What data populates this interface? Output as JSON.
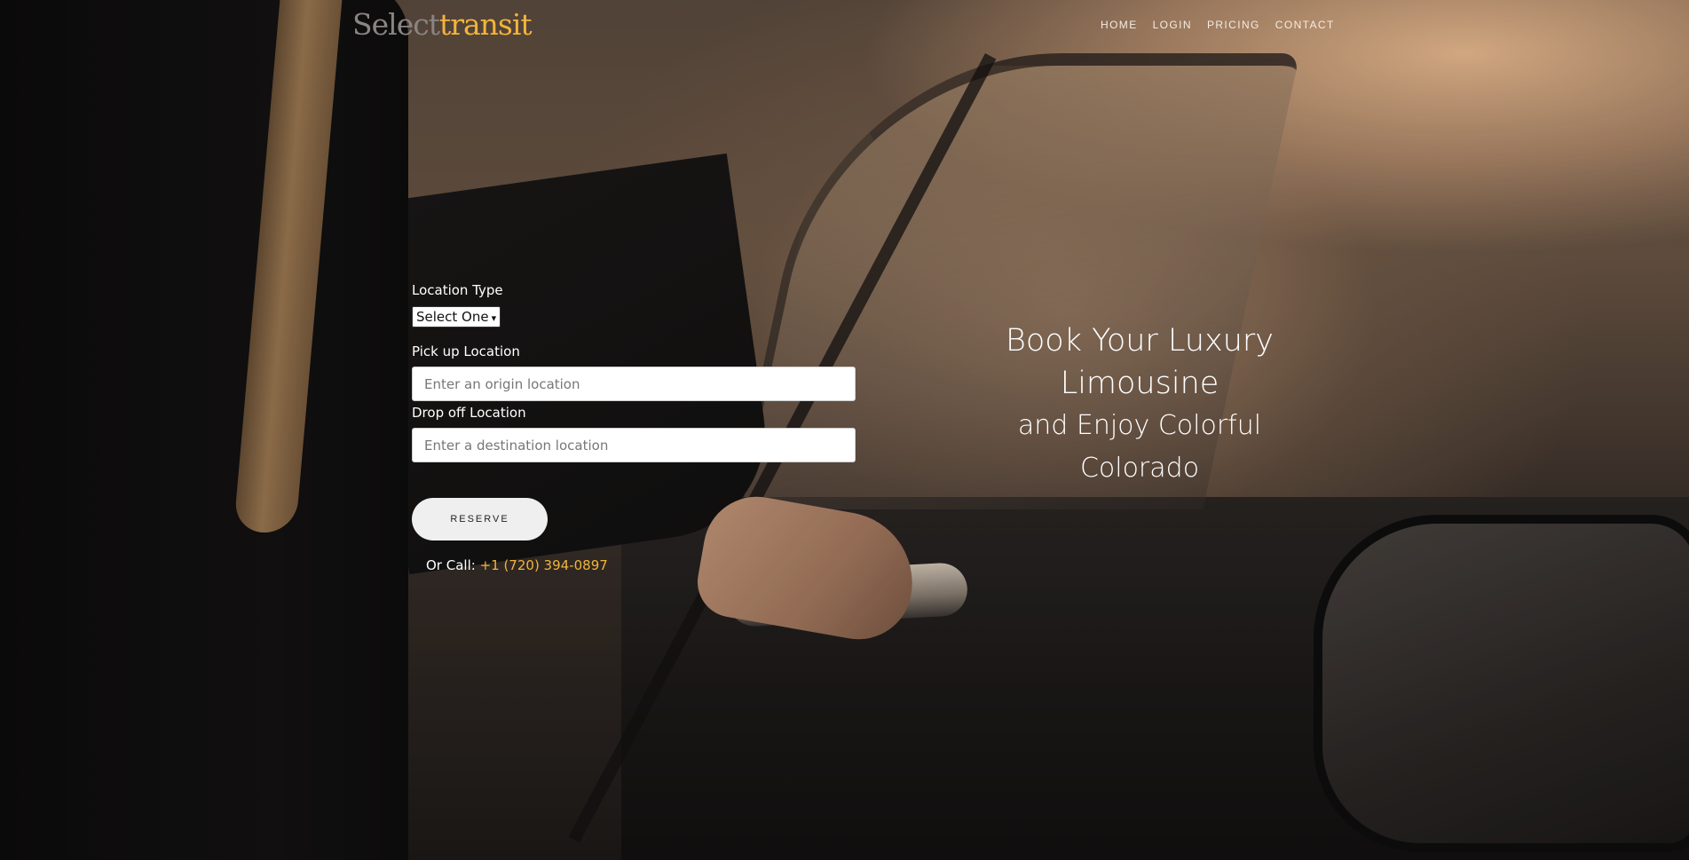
{
  "header": {
    "logo": {
      "part1": "Select",
      "part2": "transit"
    },
    "nav": [
      "HOME",
      "LOGIN",
      "PRICING",
      "CONTACT"
    ]
  },
  "form": {
    "location_type_label": "Location Type",
    "location_type_selected": "Select One",
    "pickup_label": "Pick up Location",
    "pickup_placeholder": "Enter an origin location",
    "dropoff_label": "Drop off Location",
    "dropoff_placeholder": "Enter a destination location",
    "reserve_label": "RESERVE",
    "call_prefix": "Or Call:",
    "phone": "+1 (720) 394-0897"
  },
  "headline": {
    "line1": "Book Your Luxury",
    "line2": "Limousine",
    "line3": "and Enjoy Colorful",
    "line4": "Colorado"
  },
  "colors": {
    "accent": "#f2b43a",
    "logo_gray": "#8a8583"
  }
}
